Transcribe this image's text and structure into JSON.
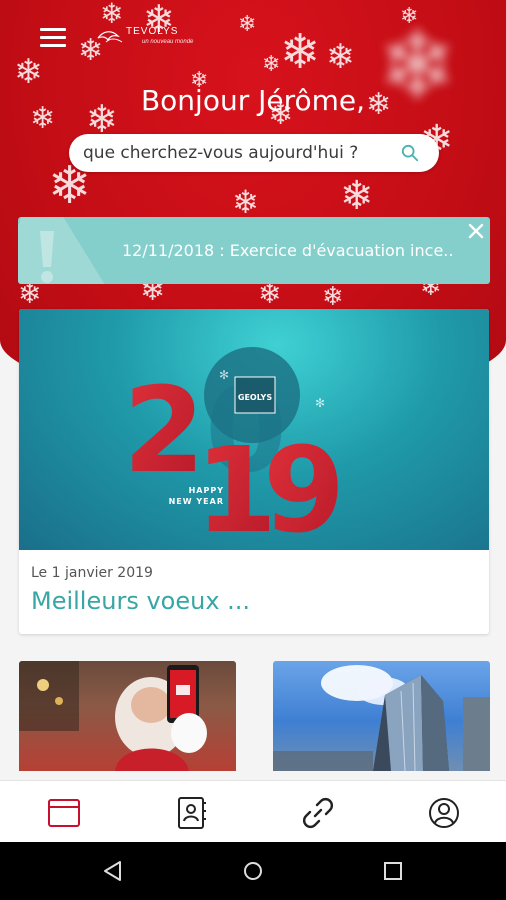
{
  "header": {
    "menu_icon": "hamburger-menu-icon",
    "brand": {
      "name": "TEVOLYS",
      "tagline": "un nouveau monde"
    }
  },
  "greeting": "Bonjour Jérôme,",
  "search": {
    "placeholder": "que cherchez-vous aujourd'hui ?",
    "icon": "search-icon"
  },
  "alert": {
    "text": "12/11/2018 : Exercice d'évacuation ince..",
    "icon": "warning-icon",
    "close_icon": "close-icon",
    "background": "#84cfcb"
  },
  "featured": {
    "image_logo": "GEOLYS",
    "image_year": "2019",
    "image_caption_line1": "HAPPY",
    "image_caption_line2": "NEW YEAR",
    "date": "Le 1 janvier 2019",
    "title": "Meilleurs voeux ...",
    "title_color": "#38a6a3"
  },
  "tiles": [
    {
      "name": "santa-phone-photo"
    },
    {
      "name": "building-photo"
    }
  ],
  "bottom_nav": [
    {
      "icon": "news-card-icon",
      "active": true,
      "color": "#c8102e"
    },
    {
      "icon": "contacts-book-icon",
      "active": false
    },
    {
      "icon": "link-icon",
      "active": false
    },
    {
      "icon": "user-profile-icon",
      "active": false
    }
  ],
  "android_nav": [
    "back-icon",
    "home-icon",
    "recents-icon"
  ],
  "colors": {
    "brand_red": "#c8102e",
    "teal": "#84cfcb"
  }
}
